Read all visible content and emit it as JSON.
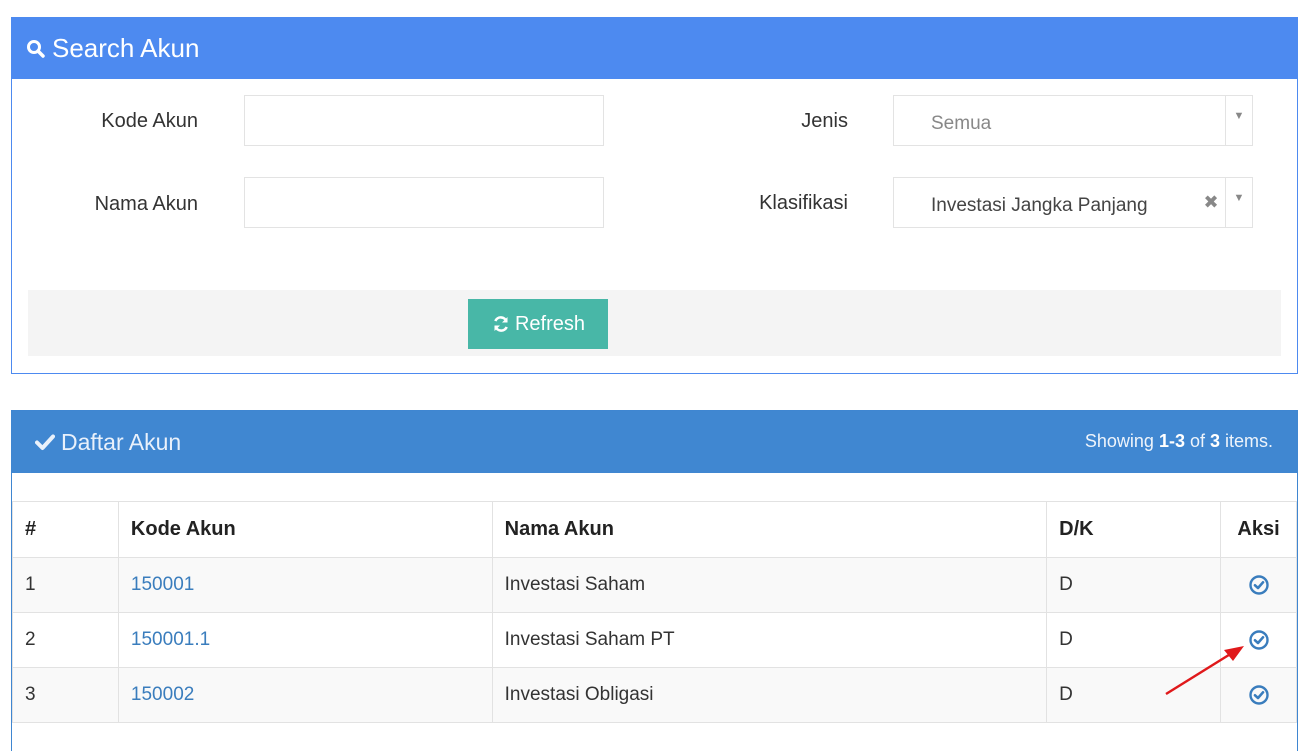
{
  "search_panel": {
    "title": "Search Akun",
    "fields": {
      "kode_akun_label": "Kode Akun",
      "kode_akun_value": "",
      "nama_akun_label": "Nama Akun",
      "nama_akun_value": "",
      "jenis_label": "Jenis",
      "jenis_value": "Semua",
      "klasifikasi_label": "Klasifikasi",
      "klasifikasi_value": "Investasi Jangka Panjang"
    },
    "refresh_label": "Refresh",
    "header_color": "#4d8af0",
    "refresh_color": "#48b7a7"
  },
  "list_panel": {
    "title": "Daftar Akun",
    "summary_prefix": "Showing ",
    "summary_range": "1-3",
    "summary_mid": " of ",
    "summary_total": "3",
    "summary_suffix": " items.",
    "header_color": "#4087d1",
    "columns": [
      "#",
      "Kode Akun",
      "Nama Akun",
      "D/K",
      "Aksi"
    ],
    "rows": [
      {
        "no": "1",
        "kode": "150001",
        "nama": "Investasi Saham",
        "dk": "D"
      },
      {
        "no": "2",
        "kode": "150001.1",
        "nama": "Investasi Saham PT",
        "dk": "D"
      },
      {
        "no": "3",
        "kode": "150002",
        "nama": "Investasi Obligasi",
        "dk": "D"
      }
    ]
  },
  "icons": {
    "search": "search-icon",
    "refresh": "refresh-icon",
    "check": "check-icon",
    "select_row": "check-circle-icon",
    "annotation": "red-arrow"
  },
  "link_color": "#3a7dbd",
  "annotation_color": "#e0191b"
}
